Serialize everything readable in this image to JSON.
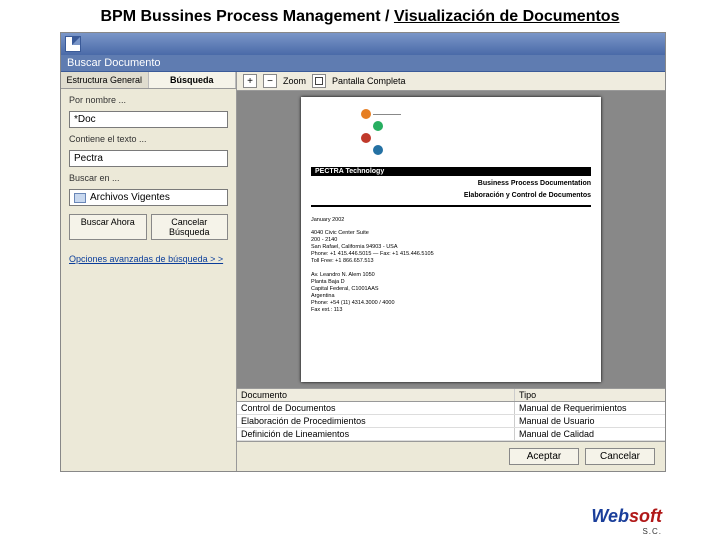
{
  "slide": {
    "title_plain": "BPM Bussines Process Management / ",
    "title_underlined": "Visualización de Documentos"
  },
  "window": {
    "header": "Buscar Documento",
    "tabs": {
      "structure": "Estructura General",
      "search": "Búsqueda"
    },
    "search": {
      "by_name_label": "Por nombre ...",
      "by_name_value": "*Doc",
      "contains_label": "Contiene el texto ...",
      "contains_value": "Pectra",
      "scope_label": "Buscar en ...",
      "scope_value": "Archivos Vigentes",
      "btn_search": "Buscar Ahora",
      "btn_cancel": "Cancelar Búsqueda",
      "advanced": "Opciones avanzadas de búsqueda  > >"
    },
    "toolbar": {
      "zoom_label": "Zoom",
      "full_label": "Pantalla Completa"
    },
    "preview": {
      "company": "PECTRA Technology",
      "heading1": "Business Process Documentation",
      "heading2": "Elaboración y Control de Documentos",
      "month": "January 2002",
      "addr1_l1": "4040 Civic Center Suite",
      "addr1_l2": "200 - 2140",
      "addr1_l3": "San Rafael, California 94903 - USA",
      "addr1_l4": "Phone: +1 415.446.5015 — Fax: +1 415.446.5105",
      "addr1_l5": "Toll Free: +1 866.657.513",
      "addr2_l1": "Av. Leandro N. Alem 1050",
      "addr2_l2": "Planta Baja D",
      "addr2_l3": "Capital Federal, C1001AAS",
      "addr2_l4": "Argentina",
      "addr2_l5": "Phone: +54 (11) 4314.3000 / 4000",
      "addr2_l6": "Fax ext.: 113"
    },
    "grid": {
      "col_doc": "Documento",
      "col_tipo": "Tipo",
      "rows": [
        {
          "doc": "Control de Documentos",
          "tipo": "Manual de Requerimientos"
        },
        {
          "doc": "Elaboración de Procedimientos",
          "tipo": "Manual de Usuario"
        },
        {
          "doc": "Definición de Lineamientos",
          "tipo": "Manual de Calidad"
        }
      ]
    },
    "dlg": {
      "accept": "Aceptar",
      "cancel": "Cancelar"
    }
  },
  "brand": {
    "name_a": "Web",
    "name_b": "soft",
    "sub": "S.C."
  }
}
